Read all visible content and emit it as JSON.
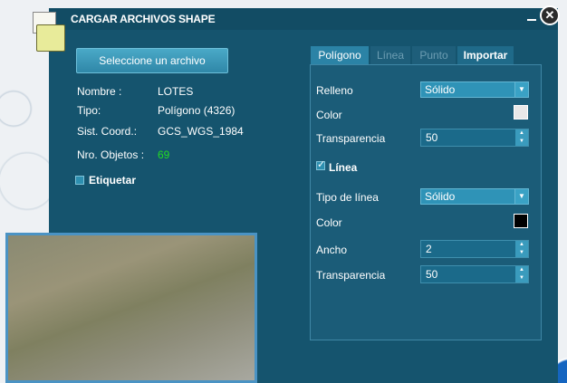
{
  "window": {
    "title": "CARGAR ARCHIVOS SHAPE"
  },
  "buttons": {
    "select_file": "Seleccione un archivo"
  },
  "info": {
    "name_label": "Nombre :",
    "name_value": "LOTES",
    "type_label": "Tipo:",
    "type_value": "Polígono (4326)",
    "coord_label": "Sist. Coord.:",
    "coord_value": "GCS_WGS_1984",
    "objects_label": "Nro. Objetos :",
    "objects_value": "69"
  },
  "label_toggle": {
    "label": "Etiquetar",
    "checked": false
  },
  "tabs": [
    {
      "label": "Polígono",
      "state": "active"
    },
    {
      "label": "Línea",
      "state": "disabled"
    },
    {
      "label": "Punto",
      "state": "disabled"
    },
    {
      "label": "Importar",
      "state": "normal"
    }
  ],
  "style": {
    "fill_label": "Relleno",
    "fill_value": "Sólido",
    "color_label": "Color",
    "fill_color": "#e8e8e8",
    "transparency_label": "Transparencia",
    "transparency_value": "50",
    "line_toggle": {
      "label": "Línea",
      "checked": true
    },
    "line_type_label": "Tipo de línea",
    "line_type_value": "Sólido",
    "line_color_label": "Color",
    "line_color": "#000000",
    "width_label": "Ancho",
    "width_value": "2",
    "line_transparency_label": "Transparencia",
    "line_transparency_value": "50"
  }
}
